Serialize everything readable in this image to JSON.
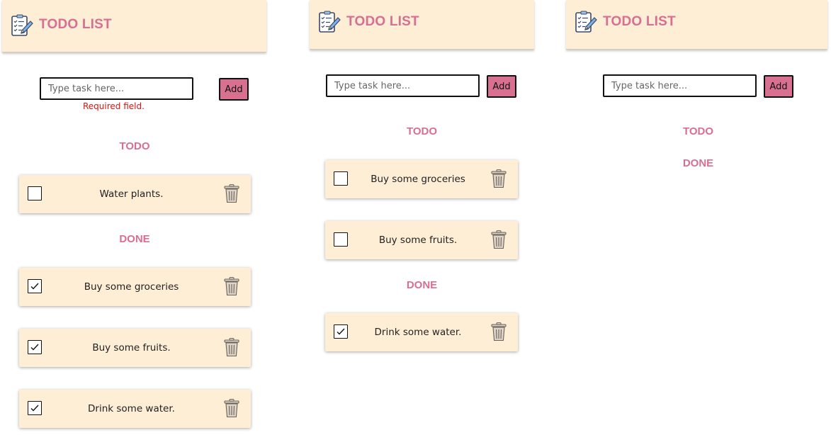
{
  "app": {
    "title": "TODO LIST"
  },
  "input": {
    "placeholder": "Type task here..."
  },
  "add_button": {
    "label": "Add"
  },
  "sections": {
    "todo": "TODO",
    "done": "DONE"
  },
  "panels": [
    {
      "error": "Required field.",
      "todo": [
        {
          "text": "Water plants.",
          "checked": false
        }
      ],
      "done": [
        {
          "text": "Buy some groceries",
          "checked": true
        },
        {
          "text": "Buy some fruits.",
          "checked": true
        },
        {
          "text": "Drink some water.",
          "checked": true
        }
      ]
    },
    {
      "todo": [
        {
          "text": "Buy some groceries",
          "checked": false
        },
        {
          "text": "Buy some fruits.",
          "checked": false
        }
      ],
      "done": [
        {
          "text": "Drink some water.",
          "checked": true
        }
      ]
    },
    {
      "todo": [],
      "done": []
    }
  ],
  "icons": {
    "logo": "checklist-pencil-icon",
    "delete": "trash-icon",
    "check": "checkmark-icon"
  },
  "colors": {
    "accent": "#d86e92",
    "header_bg": "#fdeed5",
    "card_bg": "#fdeed5",
    "error": "#dd1111",
    "button_bg": "#d8708f"
  }
}
